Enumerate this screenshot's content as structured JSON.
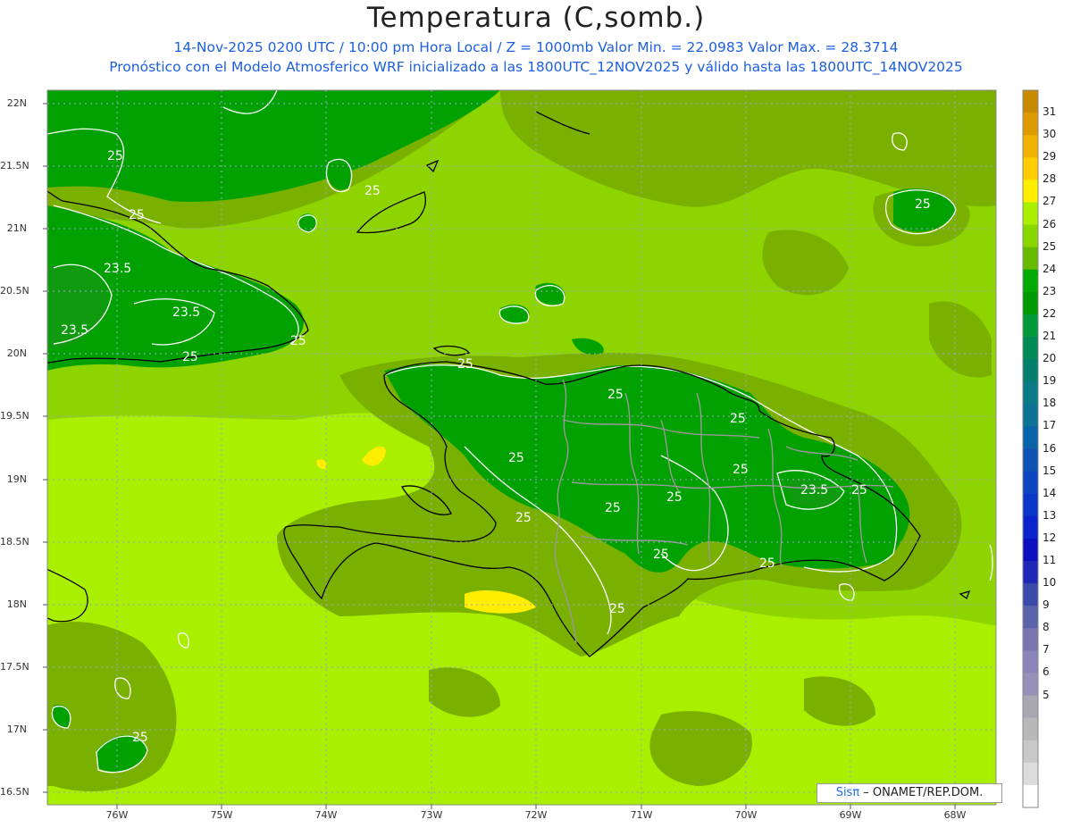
{
  "title": "Temperatura (C,somb.)",
  "subtitle_line1": "14-Nov-2025 0200 UTC / 10:00 pm Hora Local / Z = 1000mb   Valor Min. = 22.0983   Valor Max. = 28.3714",
  "subtitle_line2": "Pronóstico con el Modelo Atmosferico WRF inicializado a las 1800UTC_12NOV2025 y válido hasta las  1800UTC_14NOV2025",
  "lat_labels": [
    "22N",
    "21.5N",
    "21N",
    "20.5N",
    "20N",
    "19.5N",
    "19N",
    "18.5N",
    "18N",
    "17.5N",
    "17N",
    "16.5N"
  ],
  "lon_labels": [
    "76W",
    "75W",
    "74W",
    "73W",
    "72W",
    "71W",
    "70W",
    "69W",
    "68W"
  ],
  "contour_labels": [
    "25",
    "25",
    "23.5",
    "23.5",
    "23.5",
    "25",
    "25",
    "25",
    "25",
    "25",
    "25",
    "25",
    "25",
    "25",
    "25",
    "23.5",
    "25",
    "25",
    "25",
    "25",
    "25",
    "25",
    "25"
  ],
  "colorbar": {
    "labels": [
      "31",
      "30",
      "29",
      "28",
      "27",
      "26",
      "25",
      "24",
      "23",
      "22",
      "21",
      "20",
      "19",
      "18",
      "17",
      "16",
      "15",
      "14",
      "13",
      "12",
      "11",
      "10",
      "9",
      "8",
      "7",
      "6",
      "5"
    ],
    "colors": [
      "#c88a00",
      "#dd9b00",
      "#f2b200",
      "#ffcc00",
      "#ffee00",
      "#aaee00",
      "#88d800",
      "#66bb00",
      "#00aa00",
      "#009900",
      "#009a3a",
      "#008a55",
      "#00806c",
      "#0a7a86",
      "#0c7296",
      "#0a62a8",
      "#0d52b4",
      "#0c46c0",
      "#0a37c8",
      "#0a22cc",
      "#0a10c0",
      "#1e28b8",
      "#3a4aac",
      "#5a64aa",
      "#7a74b0",
      "#8a84b8",
      "#9890b8",
      "#a8a8b0",
      "#b8b8b8",
      "#c8c8c8",
      "#dcdcdc",
      "#ffffff"
    ]
  },
  "credit": {
    "logo": "Sisπ",
    "org": " – ONAMET/REP.DOM."
  },
  "colors": {
    "field_25_26": "#7ab000",
    "field_26_27": "#8ed400",
    "field_27_28": "#aaee00",
    "field_24_25": "#1aa800",
    "field_23_24": "#00a100",
    "contour": "#ffffff",
    "coast": "#000000",
    "border": "#999999",
    "grid": "#a0a0d8"
  }
}
